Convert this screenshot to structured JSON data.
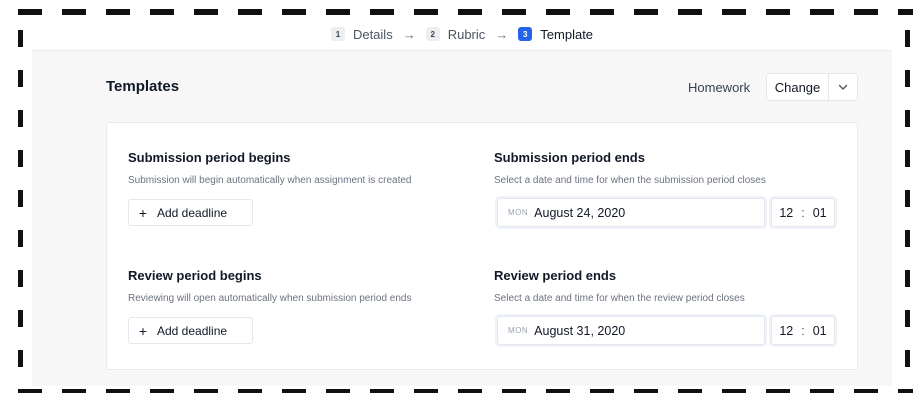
{
  "steps": [
    {
      "num": "1",
      "label": "Details"
    },
    {
      "num": "2",
      "label": "Rubric"
    },
    {
      "num": "3",
      "label": "Template"
    }
  ],
  "arrow_glyph": "→",
  "header": {
    "title": "Templates",
    "template_name": "Homework",
    "change_label": "Change"
  },
  "submission_begins": {
    "title": "Submission period begins",
    "description": "Submission will begin automatically when assignment is created",
    "add_label": "Add deadline"
  },
  "submission_ends": {
    "title": "Submission period ends",
    "description": "Select a date and time for when the submission period closes",
    "day": "MON",
    "date": "August 24, 2020",
    "hour": "12",
    "minute": "01"
  },
  "review_begins": {
    "title": "Review period begins",
    "description": "Reviewing will open automatically when submission period ends",
    "add_label": "Add deadline"
  },
  "review_ends": {
    "title": "Review period ends",
    "description": "Select a date and time for when the review period closes",
    "day": "MON",
    "date": "August 31, 2020",
    "hour": "12",
    "minute": "01"
  },
  "colors": {
    "accent": "#2563eb",
    "page_bg": "#f7f7f8",
    "card_bg": "#ffffff",
    "border": "#e5e7eb"
  },
  "icons": {
    "plus": "plus-icon",
    "chevron": "chevron-down-icon"
  }
}
